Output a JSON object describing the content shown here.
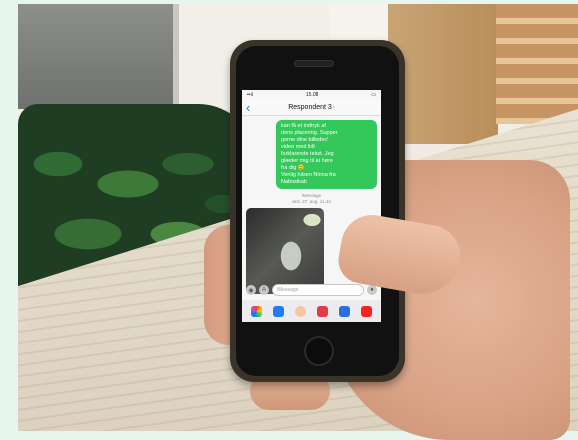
{
  "phone": {
    "status_time": "15.08",
    "contact_name": "Respondent 3",
    "message_text": "kan få et indtryk af\ndens placering. Supper\ngerne dine billeder/\nvideo med lidt\nforklarende tekst. Jeg\nglæder mig til at høre\nfra dig 😊\nVenlig hilsen Ninna fra\nNabosikab",
    "message_meta": "iMessage\nøns. 27. aug. 11.43",
    "input_placeholder": "iMessage"
  },
  "colors": {
    "imessage_green": "#34c759",
    "ios_blue": "#1f7cf6"
  },
  "icons": {
    "back": "chevron-left-icon",
    "camera": "camera-icon",
    "appstore": "app-store-icon",
    "mic": "microphone-icon"
  }
}
